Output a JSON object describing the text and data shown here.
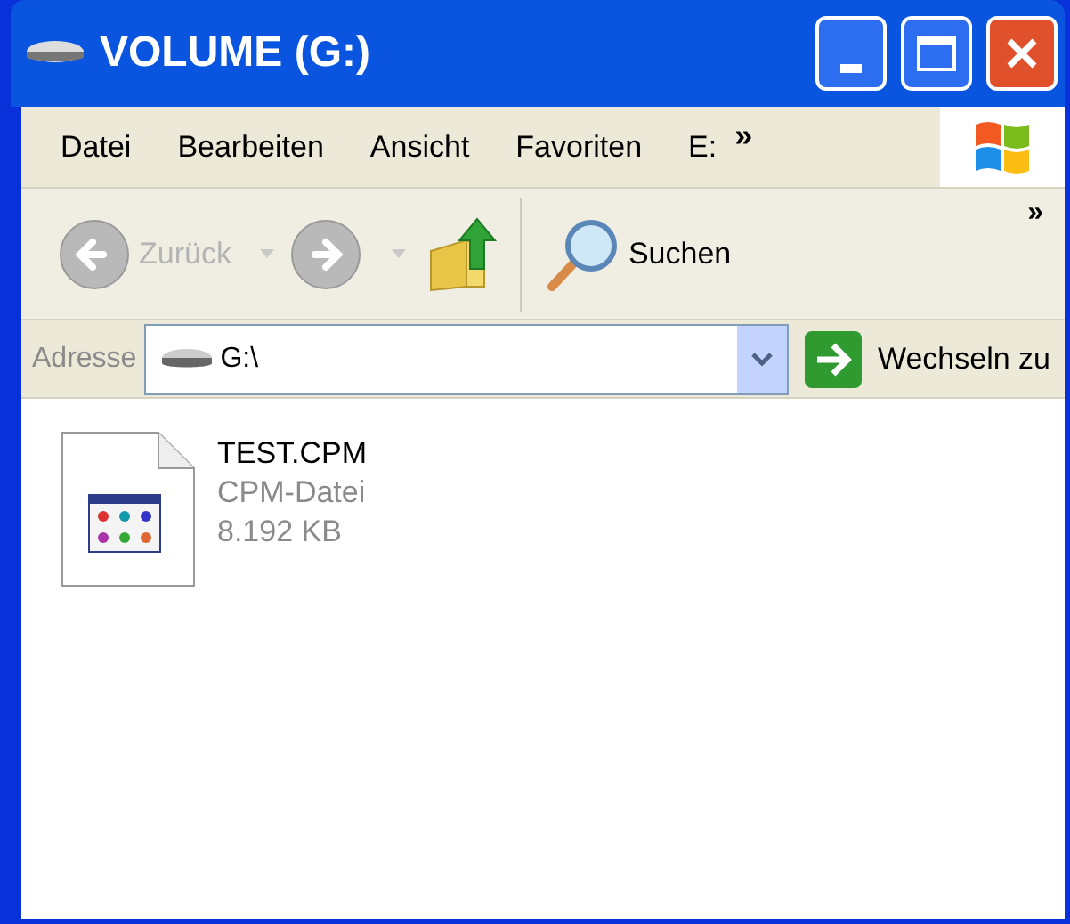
{
  "window": {
    "title": "VOLUME (G:)"
  },
  "menu": [
    {
      "label": "Datei"
    },
    {
      "label": "Bearbeiten"
    },
    {
      "label": "Ansicht"
    },
    {
      "label": "Favoriten"
    },
    {
      "label": "E:"
    }
  ],
  "menu_overflow": "»",
  "toolbar": [
    {
      "kind": "back",
      "label": "Zurück",
      "disabled": true
    },
    {
      "kind": "forward",
      "disabled": true
    },
    {
      "kind": "up",
      "disabled": false
    },
    {
      "kind": "search",
      "label": "Suchen",
      "disabled": false
    }
  ],
  "toolbar_overflow": "»",
  "address": {
    "label": "Adresse",
    "value": "G:\\",
    "go_label": "Wechseln zu"
  },
  "files": [
    {
      "name": "TEST.CPM",
      "type": "CPM-Datei",
      "size": "8.192 KB"
    }
  ]
}
